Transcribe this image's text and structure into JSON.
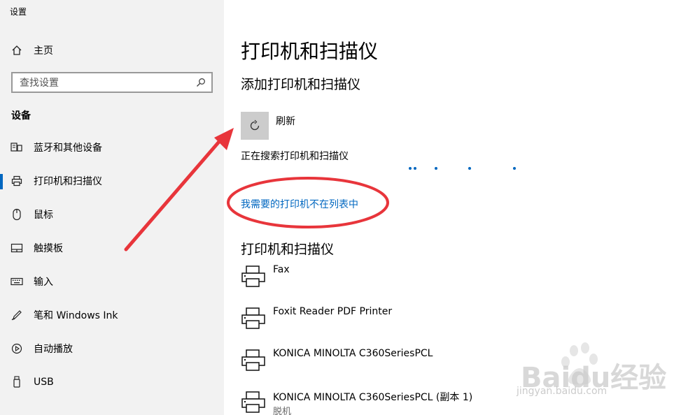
{
  "app_title": "设置",
  "sidebar": {
    "home_label": "主页",
    "search_placeholder": "查找设置",
    "section_label": "设备",
    "items": [
      {
        "label": "蓝牙和其他设备",
        "icon": "bluetooth-devices-icon"
      },
      {
        "label": "打印机和扫描仪",
        "icon": "printer-icon",
        "active": true
      },
      {
        "label": "鼠标",
        "icon": "mouse-icon"
      },
      {
        "label": "触摸板",
        "icon": "touchpad-icon"
      },
      {
        "label": "输入",
        "icon": "keyboard-icon"
      },
      {
        "label": "笔和 Windows Ink",
        "icon": "pen-icon"
      },
      {
        "label": "自动播放",
        "icon": "autoplay-icon"
      },
      {
        "label": "USB",
        "icon": "usb-icon"
      }
    ]
  },
  "main": {
    "title": "打印机和扫描仪",
    "add_title": "添加打印机和扫描仪",
    "refresh_label": "刷新",
    "searching_text": "正在搜索打印机和扫描仪",
    "missing_link": "我需要的打印机不在列表中",
    "list_title": "打印机和扫描仪",
    "printers": [
      {
        "name": "Fax",
        "status": ""
      },
      {
        "name": "Foxit Reader PDF Printer",
        "status": ""
      },
      {
        "name": "KONICA MINOLTA C360SeriesPCL",
        "status": ""
      },
      {
        "name": "KONICA MINOLTA C360SeriesPCL (副本 1)",
        "status": "脱机"
      }
    ]
  },
  "watermark": {
    "brand": "Baidu经验",
    "url": "jingyan.baidu.com"
  },
  "colors": {
    "accent": "#0067c0",
    "annotation": "#e8353b",
    "sidebar_bg": "#f2f2f2"
  }
}
